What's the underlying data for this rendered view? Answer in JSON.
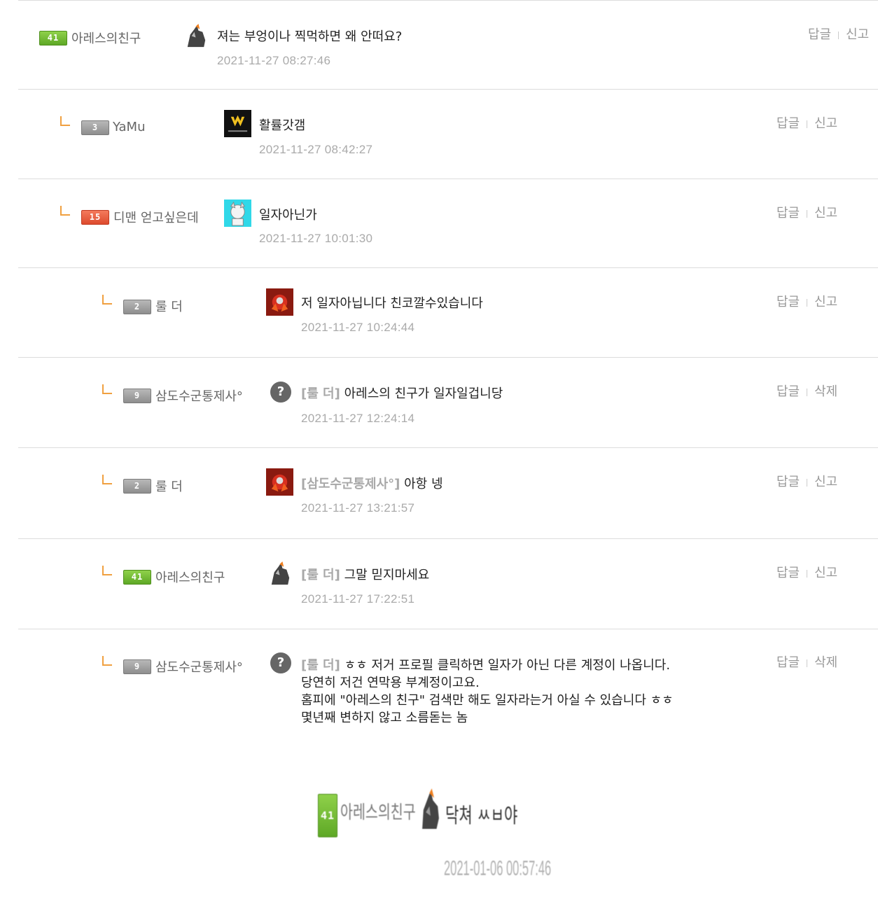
{
  "actions": {
    "reply": "답글",
    "report": "신고",
    "delete": "삭제"
  },
  "comments": [
    {
      "level": "41",
      "nick": "아레스의친구",
      "tag": "",
      "text": "져는 부엉이나 찍먹하면 왜 안떠요?",
      "date": "2021-11-27 08:27:46",
      "action2": "신고"
    },
    {
      "level": "3",
      "nick": "YaMu",
      "tag": "",
      "text": "활률갓갬",
      "date": "2021-11-27 08:42:27",
      "action2": "신고"
    },
    {
      "level": "15",
      "nick": "디맨 얻고싶은데",
      "tag": "",
      "text": "일자아닌가",
      "date": "2021-11-27 10:01:30",
      "action2": "신고"
    },
    {
      "level": "2",
      "nick": "룰 더",
      "tag": "",
      "text": "저 일자아닙니다 친코깔수있습니다",
      "date": "2021-11-27 10:24:44",
      "action2": "신고"
    },
    {
      "level": "9",
      "nick": "삼도수군통제사°",
      "tag": "[룰 더]",
      "text": "아레스의 친구가 일자일겁니당",
      "date": "2021-11-27 12:24:14",
      "action2": "삭제"
    },
    {
      "level": "2",
      "nick": "룰 더",
      "tag": "[삼도수군통제사°]",
      "text": "아항 넹",
      "date": "2021-11-27 13:21:57",
      "action2": "신고"
    },
    {
      "level": "41",
      "nick": "아레스의친구",
      "tag": "[룰 더]",
      "text": "그말 믿지마세요",
      "date": "2021-11-27 17:22:51",
      "action2": "신고"
    },
    {
      "level": "9",
      "nick": "삼도수군통제사°",
      "tag": "[룰 더]",
      "text_lines": [
        "ㅎㅎ 저거 프로필 클릭하면 일자가 아닌 다른 계정이 나옵니다.",
        "당연히 저건 연막용 부계정이고요.",
        "홈피에 \"아레스의 친구\" 검색만 해도 일자라는거 아실 수 있습니다 ㅎㅎ",
        "몇년째 변하지 않고 소름돋는 놈"
      ],
      "action2": "삭제"
    }
  ],
  "signature": {
    "level": "41",
    "nick": "아레스의친구",
    "text": "닥쳐 ㅆㅂ야",
    "date": "2021-01-06 00:57:46"
  },
  "colors": {
    "level_green": "#6db52f",
    "level_gray": "#9a9a9a",
    "level_red": "#e4583a",
    "reply_mark": "#f0a040",
    "date": "#aaaaaa"
  },
  "icons": {
    "reply_indicator": "reply-corner-icon",
    "default_avatar": "question-mark-avatar-icon"
  }
}
